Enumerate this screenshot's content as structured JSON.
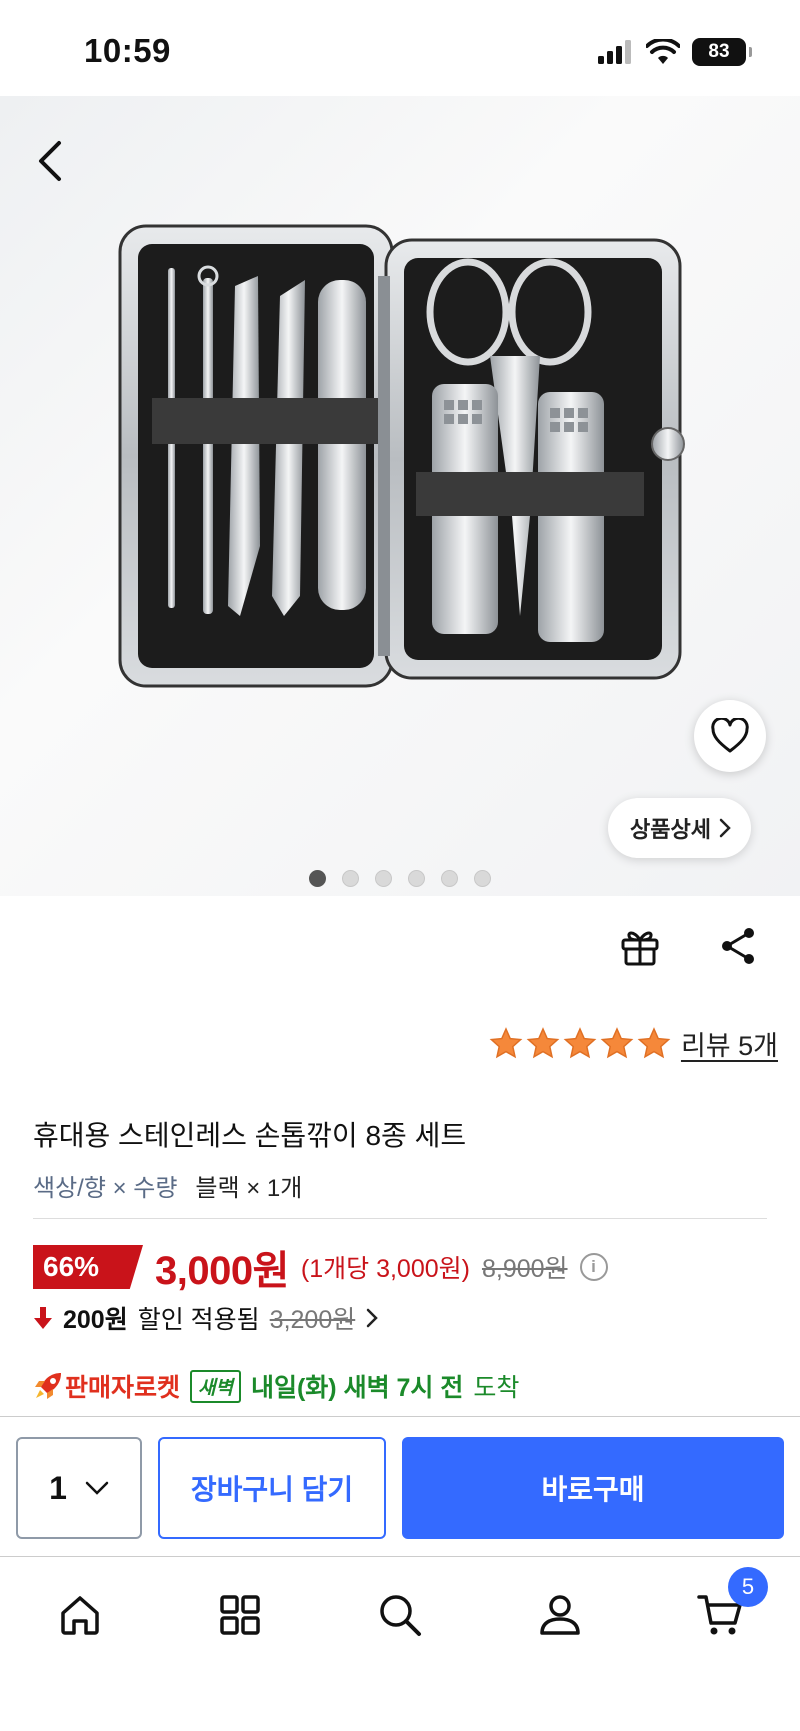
{
  "status_bar": {
    "time": "10:59",
    "battery": "83"
  },
  "hero": {
    "image_name": "nail-clipper-8-piece-set-photo",
    "detail_label": "상품상세",
    "dots": [
      true,
      false,
      false,
      false,
      false,
      false
    ]
  },
  "rating": {
    "stars": 5,
    "review_label": "리뷰 5개"
  },
  "product": {
    "title": "휴대용 스테인레스 손톱깎이 8종 세트",
    "option_label": "색상/향 × 수량",
    "option_value": "블랙 × 1개"
  },
  "price": {
    "discount": "66%",
    "sale": "3,000원",
    "unit": "(1개당 3,000원)",
    "original": "8,900원"
  },
  "coupon": {
    "amount": "200원",
    "label": "할인 적용됨",
    "previous": "3,200원"
  },
  "delivery": {
    "seller_label": "판매자로켓",
    "badge": "새벽",
    "arrival_strong": "내일(화) 새벽 7시 전",
    "arrival_suffix": "도착"
  },
  "purchase_bar": {
    "quantity": "1",
    "cart_label": "장바구니 담기",
    "buy_label": "바로구매"
  },
  "bottom_nav": {
    "cart_count": "5"
  },
  "colors": {
    "brand_blue": "#346aff",
    "sale_red": "#c9131a",
    "rocket_green": "#1b8a2a",
    "star_orange": "#f5883a"
  }
}
